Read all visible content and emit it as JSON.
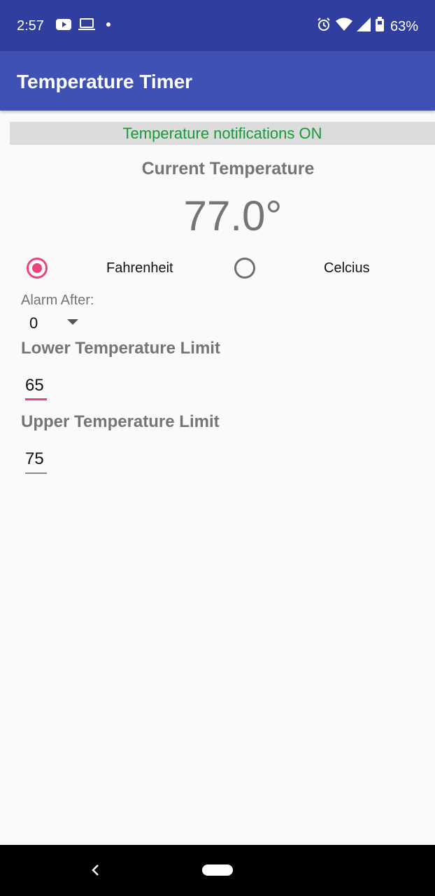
{
  "status_bar": {
    "time": "2:57",
    "battery_percent": "63%",
    "left_icons": [
      "youtube-icon",
      "laptop-icon",
      "dot-icon"
    ],
    "right_icons": [
      "alarm-icon",
      "wifi-icon",
      "signal-icon",
      "battery-icon"
    ]
  },
  "app_bar": {
    "title": "Temperature Timer"
  },
  "notification_banner": {
    "text": "Temperature notifications ON",
    "color": "#159b35"
  },
  "current_temperature": {
    "label": "Current Temperature",
    "value": "77.0°"
  },
  "units": {
    "options": [
      "Fahrenheit",
      "Celcius"
    ],
    "fahrenheit_label": "Fahrenheit",
    "celcius_label": "Celcius",
    "selected": "Fahrenheit"
  },
  "alarm": {
    "label": "Alarm After:",
    "selected_value": "0"
  },
  "lower_limit": {
    "label": "Lower Temperature Limit",
    "value": "65"
  },
  "upper_limit": {
    "label": "Upper Temperature Limit",
    "value": "75"
  },
  "colors": {
    "status_bar": "#303f9f",
    "app_bar": "#3f51b5",
    "accent": "#e8457a",
    "banner_text": "#159b35"
  },
  "nav_bar": {
    "icons": [
      "back-icon",
      "home-pill-icon"
    ]
  }
}
